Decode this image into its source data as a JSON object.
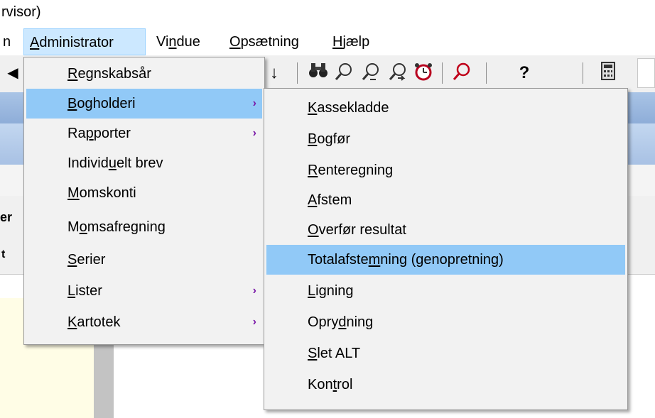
{
  "window": {
    "title_fragment": "rvisor)"
  },
  "menubar": {
    "items": [
      {
        "label": "n"
      },
      {
        "label": "Administrator",
        "pre": "",
        "ul": "A",
        "post": "dministrator"
      },
      {
        "label": "Vindue",
        "pre": "Vi",
        "ul": "n",
        "post": "due"
      },
      {
        "label": "Opsætning",
        "pre": "",
        "ul": "O",
        "post": "psætning"
      },
      {
        "label": "Hjælp",
        "pre": "",
        "ul": "H",
        "post": "jælp"
      }
    ]
  },
  "toolbar": {
    "buttons": [
      {
        "icon": "left-arrow-icon",
        "glyph": "◀"
      },
      {
        "icon": "down-arrow-icon",
        "glyph": "↓"
      },
      {
        "icon": "binoculars-icon",
        "glyph": "👁"
      },
      {
        "icon": "zoom-icon",
        "glyph": "⚲"
      },
      {
        "icon": "zoom-prev-icon",
        "glyph": "⚲"
      },
      {
        "icon": "zoom-next-icon",
        "glyph": "⚲"
      },
      {
        "icon": "alarm-clock-icon",
        "glyph": "⏰"
      },
      {
        "icon": "magnifier-icon",
        "glyph": "⚲"
      },
      {
        "icon": "help-icon",
        "glyph": "?"
      },
      {
        "icon": "calculator-icon",
        "glyph": "▦"
      }
    ]
  },
  "background": {
    "fragment_1": "er",
    "fragment_2": "t"
  },
  "admin_menu": {
    "items": [
      {
        "pre": "",
        "ul": "R",
        "post": "egnskabsår",
        "submenu": false,
        "highlighted": false
      },
      {
        "pre": "",
        "ul": "B",
        "post": "ogholderi",
        "submenu": true,
        "highlighted": true
      },
      {
        "pre": "Ra",
        "ul": "p",
        "post": "porter",
        "submenu": true,
        "highlighted": false
      },
      {
        "pre": "Individ",
        "ul": "u",
        "post": "elt brev",
        "submenu": false,
        "highlighted": false
      },
      {
        "pre": "",
        "ul": "M",
        "post": "omskonti",
        "submenu": false,
        "highlighted": false
      },
      {
        "pre": "M",
        "ul": "o",
        "post": "msafregning",
        "submenu": false,
        "highlighted": false
      },
      {
        "pre": "",
        "ul": "S",
        "post": "erier",
        "submenu": false,
        "highlighted": false
      },
      {
        "pre": "",
        "ul": "L",
        "post": "ister",
        "submenu": true,
        "highlighted": false
      },
      {
        "pre": "",
        "ul": "K",
        "post": "artotek",
        "submenu": true,
        "highlighted": false
      }
    ]
  },
  "bogholderi_menu": {
    "items": [
      {
        "pre": "",
        "ul": "K",
        "post": "assekladde",
        "highlighted": false
      },
      {
        "pre": "",
        "ul": "B",
        "post": "ogfør",
        "highlighted": false
      },
      {
        "pre": "",
        "ul": "R",
        "post": "enteregning",
        "highlighted": false
      },
      {
        "pre": "",
        "ul": "A",
        "post": "fstem",
        "highlighted": false
      },
      {
        "pre": "",
        "ul": "O",
        "post": "verfør resultat",
        "highlighted": false
      },
      {
        "pre": "Totalafste",
        "ul": "m",
        "post": "ning (genopretning)",
        "highlighted": true
      },
      {
        "pre": "",
        "ul": "L",
        "post": "igning",
        "highlighted": false
      },
      {
        "pre": "Opry",
        "ul": "d",
        "post": "ning",
        "highlighted": false
      },
      {
        "pre": "",
        "ul": "S",
        "post": "let ALT",
        "highlighted": false
      },
      {
        "pre": "Kon",
        "ul": "t",
        "post": "rol",
        "highlighted": false
      }
    ]
  },
  "colors": {
    "menu_highlight": "#91c9f7",
    "menubar_active": "#cce8ff",
    "submenu_arrow": "#7a18a8",
    "header_band": "#a9c4e6"
  }
}
